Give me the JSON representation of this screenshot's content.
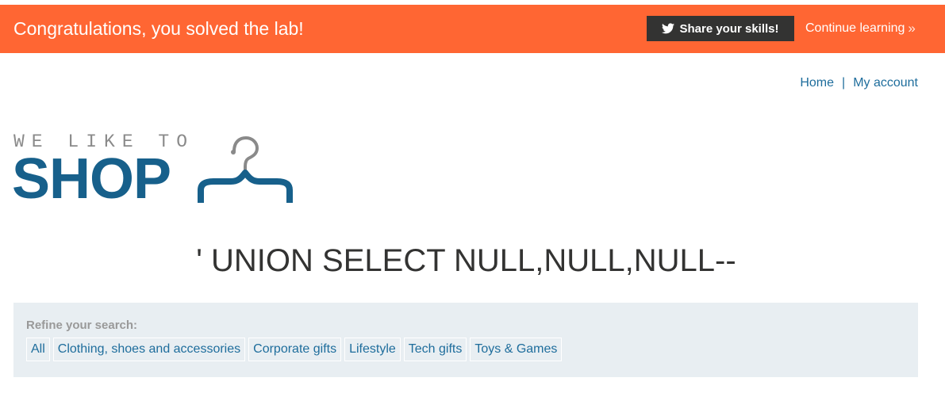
{
  "banner": {
    "message": "Congratulations, you solved the lab!",
    "share_label": "Share your skills!",
    "continue_label": "Continue learning",
    "background_color": "#ff6633"
  },
  "nav": {
    "items": [
      {
        "label": "Home"
      },
      {
        "label": "My account"
      }
    ],
    "separator": "|"
  },
  "logo": {
    "tagline": "WE LIKE TO",
    "word": "SHOP",
    "icon": "hanger-icon"
  },
  "page": {
    "title": "' UNION SELECT NULL,NULL,NULL--"
  },
  "filters": {
    "label": "Refine your search:",
    "items": [
      {
        "label": "All"
      },
      {
        "label": "Clothing, shoes and accessories"
      },
      {
        "label": "Corporate gifts"
      },
      {
        "label": "Lifestyle"
      },
      {
        "label": "Tech gifts"
      },
      {
        "label": "Toys & Games"
      }
    ]
  },
  "colors": {
    "brand_blue": "#17608b",
    "link_blue": "#1e6d9c",
    "panel_bg": "#e8eef2",
    "dark_button": "#333332"
  }
}
